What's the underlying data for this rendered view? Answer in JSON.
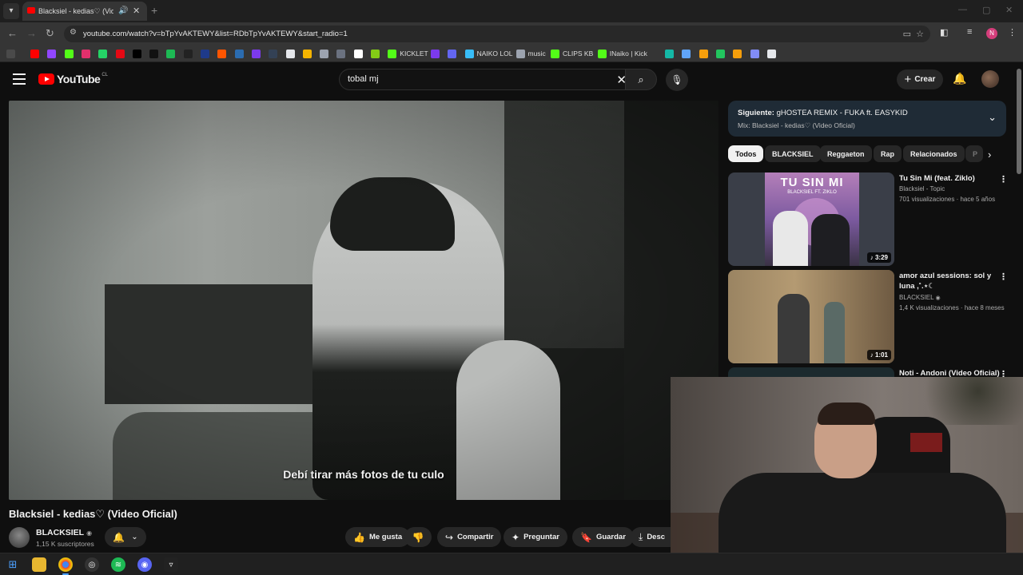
{
  "browser": {
    "tab_title": "Blacksiel - kedias♡ (Video O",
    "url": "youtube.com/watch?v=bTpYvAKTEWY&list=RDbTpYvAKTEWY&start_radio=1",
    "bookmarks": [
      {
        "label": "",
        "color": "#ff0000"
      },
      {
        "label": "",
        "color": "#9146ff"
      },
      {
        "label": "",
        "color": "#53fc18"
      },
      {
        "label": "",
        "color": "#e1306c"
      },
      {
        "label": "",
        "color": "#25d366"
      },
      {
        "label": "",
        "color": "#e50914"
      },
      {
        "label": "",
        "color": "#000000"
      },
      {
        "label": "",
        "color": "#111111"
      },
      {
        "label": "",
        "color": "#1db954"
      },
      {
        "label": "",
        "color": "#222222"
      },
      {
        "label": "",
        "color": "#1e3a8a"
      },
      {
        "label": "",
        "color": "#ff5500"
      },
      {
        "label": "",
        "color": "#2b6cb0"
      },
      {
        "label": "",
        "color": "#7c3aed"
      },
      {
        "label": "",
        "color": "#334155"
      },
      {
        "label": "",
        "color": "#e5e7eb"
      },
      {
        "label": "",
        "color": "#f5b400"
      },
      {
        "label": "",
        "color": "#9ca3af"
      },
      {
        "label": "",
        "color": "#6b7280"
      },
      {
        "label": "",
        "color": "#ffffff"
      },
      {
        "label": "",
        "color": "#84cc16"
      },
      {
        "label": "KICKLET",
        "color": "#53fc18"
      },
      {
        "label": "",
        "color": "#7c3aed"
      },
      {
        "label": "",
        "color": "#6366f1"
      },
      {
        "label": "NAIKO LOL",
        "color": "#38bdf8"
      },
      {
        "label": "music",
        "color": "#9ca3af"
      },
      {
        "label": "CLIPS KB",
        "color": "#53fc18"
      },
      {
        "label": "INaiko | Kick",
        "color": "#53fc18"
      },
      {
        "label": "",
        "color": "#14b8a6"
      },
      {
        "label": "",
        "color": "#60a5fa"
      },
      {
        "label": "",
        "color": "#f59e0b"
      },
      {
        "label": "",
        "color": "#22c55e"
      },
      {
        "label": "",
        "color": "#f59e0b"
      },
      {
        "label": "",
        "color": "#818cf8"
      },
      {
        "label": "",
        "color": "#e5e7eb"
      }
    ],
    "profile_initial": "N"
  },
  "header": {
    "logo_text": "YouTube",
    "country_code": "CL",
    "search_value": "tobal mj",
    "create_label": "Crear"
  },
  "video": {
    "subtitle": "Debí tirar más fotos de tu culo",
    "title": "Blacksiel - kedias♡ (Video Oficial)",
    "channel": "BLACKSIEL",
    "subscribers": "1,15 K suscriptores"
  },
  "actions": {
    "like": "Me gusta",
    "share": "Compartir",
    "ask": "Preguntar",
    "save": "Guardar",
    "download": "Desc"
  },
  "mix": {
    "next_prefix": "Siguiente:",
    "next_title": "gHOSTEA REMIX - FUKA ft. EASYKID",
    "mix_name": "Mix: Blacksiel - kedias♡ (Video Oficial)"
  },
  "chips": [
    "Todos",
    "BLACKSIEL",
    "Reggaeton",
    "Rap",
    "Relacionados",
    "P"
  ],
  "related": [
    {
      "title": "Tu Sin Mi (feat. Ziklo)",
      "channel": "Blacksiel - Topic",
      "meta": "701 visualizaciones · hace 5 años",
      "duration": "3:29",
      "thumb_text": "TU SIN MI",
      "thumb_sub": "BLACKSIEL FT. ZIKLO"
    },
    {
      "title": "amor azul sessions: sol y luna ,˚.⋆☾",
      "channel": "BLACKSIEL",
      "meta": "1,4 K visualizaciones · hace 8 meses",
      "duration": "1:01"
    },
    {
      "title": "Noti - Andoni (Video Oficial)"
    }
  ]
}
